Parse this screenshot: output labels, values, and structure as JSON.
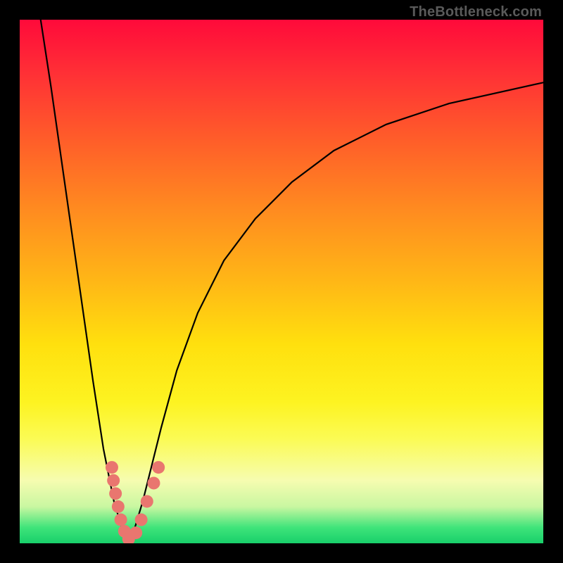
{
  "watermark": "TheBottleneck.com",
  "chart_data": {
    "type": "line",
    "title": "",
    "xlabel": "",
    "ylabel": "",
    "xlim": [
      0,
      100
    ],
    "ylim": [
      0,
      100
    ],
    "grid": false,
    "legend": false,
    "background": "vertical_gradient_red_to_green",
    "series": [
      {
        "name": "left-branch",
        "x": [
          4,
          6,
          8,
          10,
          12,
          14,
          16,
          18,
          19.5,
          21
        ],
        "y": [
          100,
          87,
          73,
          59,
          45,
          31,
          18,
          8,
          3,
          0
        ]
      },
      {
        "name": "right-branch",
        "x": [
          21,
          22,
          23.5,
          25,
          27,
          30,
          34,
          39,
          45,
          52,
          60,
          70,
          82,
          100
        ],
        "y": [
          0,
          3,
          8,
          14,
          22,
          33,
          44,
          54,
          62,
          69,
          75,
          80,
          84,
          88
        ]
      }
    ],
    "markers": [
      {
        "name": "cluster-left",
        "shape": "circle",
        "color": "#e9766f",
        "radius_px": 9,
        "points": [
          {
            "x": 17.6,
            "y": 14.5
          },
          {
            "x": 17.9,
            "y": 12.0
          },
          {
            "x": 18.3,
            "y": 9.5
          },
          {
            "x": 18.8,
            "y": 7.0
          },
          {
            "x": 19.3,
            "y": 4.5
          },
          {
            "x": 20.0,
            "y": 2.3
          },
          {
            "x": 20.8,
            "y": 0.8
          }
        ]
      },
      {
        "name": "cluster-right",
        "shape": "circle",
        "color": "#e9766f",
        "radius_px": 9,
        "points": [
          {
            "x": 22.2,
            "y": 2.0
          },
          {
            "x": 23.2,
            "y": 4.5
          },
          {
            "x": 24.3,
            "y": 8.0
          },
          {
            "x": 25.6,
            "y": 11.5
          },
          {
            "x": 26.5,
            "y": 14.5
          }
        ]
      }
    ],
    "gradient_stops": [
      {
        "pos": 0.0,
        "color": "#ff0a3a"
      },
      {
        "pos": 0.1,
        "color": "#ff2f36"
      },
      {
        "pos": 0.22,
        "color": "#ff5a2a"
      },
      {
        "pos": 0.36,
        "color": "#ff8a20"
      },
      {
        "pos": 0.5,
        "color": "#ffb716"
      },
      {
        "pos": 0.62,
        "color": "#ffe00e"
      },
      {
        "pos": 0.73,
        "color": "#fdf321"
      },
      {
        "pos": 0.8,
        "color": "#fbfb54"
      },
      {
        "pos": 0.88,
        "color": "#f6fcb0"
      },
      {
        "pos": 0.93,
        "color": "#c9f7a1"
      },
      {
        "pos": 0.97,
        "color": "#3fe47a"
      },
      {
        "pos": 1.0,
        "color": "#18cf6a"
      }
    ]
  }
}
